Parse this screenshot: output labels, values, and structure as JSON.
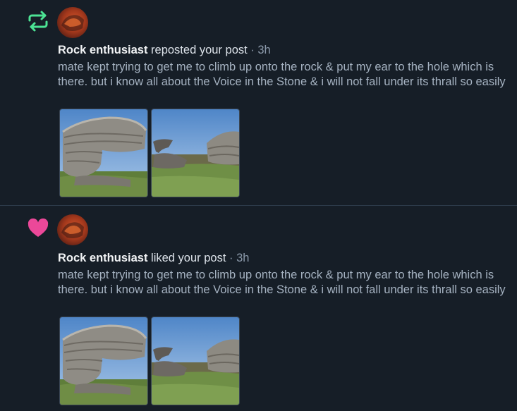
{
  "notifications": [
    {
      "type": "repost",
      "icon": "repost-icon",
      "icon_color": "#4ce394",
      "author": "Rock enthusiast",
      "action": " reposted your post",
      "time": " · 3h",
      "text": "mate kept trying to get me to climb up onto the rock & put my ear to the hole which is there. but i know all about the Voice in the Stone & i will not fall under its thrall so easily",
      "images": [
        "rock-photo-1",
        "rock-photo-2"
      ]
    },
    {
      "type": "like",
      "icon": "heart-icon",
      "icon_color": "#ec4899",
      "author": "Rock enthusiast",
      "action": " liked your post",
      "time": " · 3h",
      "text": "mate kept trying to get me to climb up onto the rock & put my ear to the hole which is there. but i know all about the Voice in the Stone & i will not fall under its thrall so easily",
      "images": [
        "rock-photo-1",
        "rock-photo-2"
      ]
    }
  ]
}
